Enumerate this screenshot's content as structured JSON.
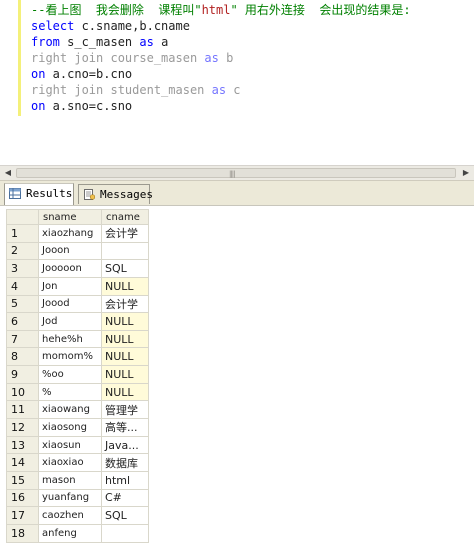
{
  "editor": {
    "comment_prefix": "--看上图  我会删除  课程叫\"",
    "comment_str": "html",
    "comment_suffix": "\" 用右外连接  会出现的结果是:",
    "lines": [
      {
        "kw": "select",
        "rest": " c.sname,b.cname",
        "faint": false
      },
      {
        "kw": "from",
        "rest": " s_c_masen ",
        "kw2": "as",
        "rest2": " a",
        "faint": false
      },
      {
        "kw": "right join",
        "rest": " course_masen ",
        "kw2": "as",
        "rest2": " b",
        "faint": true
      },
      {
        "kw": "on",
        "rest": " a.cno=b.cno",
        "faint": false
      },
      {
        "kw": "right join",
        "rest": " student_masen ",
        "kw2": "as",
        "rest2": " c",
        "faint": true
      },
      {
        "kw": "on",
        "rest": " a.sno=c.sno",
        "faint": false
      }
    ]
  },
  "tabs": {
    "results_label": "Results",
    "messages_label": "Messages"
  },
  "grid": {
    "columns": [
      "sname",
      "cname"
    ],
    "rows": [
      {
        "n": "1",
        "sname": "xiaozhang",
        "cname": "会计学"
      },
      {
        "n": "2",
        "sname": "Jooon",
        "cname": ""
      },
      {
        "n": "3",
        "sname": "Jooooon",
        "cname": "SQL"
      },
      {
        "n": "4",
        "sname": "Jon",
        "cname": "NULL"
      },
      {
        "n": "5",
        "sname": "Joood",
        "cname": "会计学"
      },
      {
        "n": "6",
        "sname": "Jod",
        "cname": "NULL"
      },
      {
        "n": "7",
        "sname": "hehe%h",
        "cname": "NULL"
      },
      {
        "n": "8",
        "sname": "momom%",
        "cname": "NULL"
      },
      {
        "n": "9",
        "sname": "%oo",
        "cname": "NULL"
      },
      {
        "n": "10",
        "sname": "%",
        "cname": "NULL"
      },
      {
        "n": "11",
        "sname": "xiaowang",
        "cname": "管理学"
      },
      {
        "n": "12",
        "sname": "xiaosong",
        "cname": "高等..."
      },
      {
        "n": "13",
        "sname": "xiaosun",
        "cname": "Java..."
      },
      {
        "n": "14",
        "sname": "xiaoxiao",
        "cname": "数据库"
      },
      {
        "n": "15",
        "sname": "mason",
        "cname": "html"
      },
      {
        "n": "16",
        "sname": "yuanfang",
        "cname": "C#"
      },
      {
        "n": "17",
        "sname": "caozhen",
        "cname": "SQL"
      },
      {
        "n": "18",
        "sname": "anfeng",
        "cname": ""
      }
    ]
  },
  "icons": {
    "results_tab": "grid-icon",
    "messages_tab": "document-icon"
  }
}
